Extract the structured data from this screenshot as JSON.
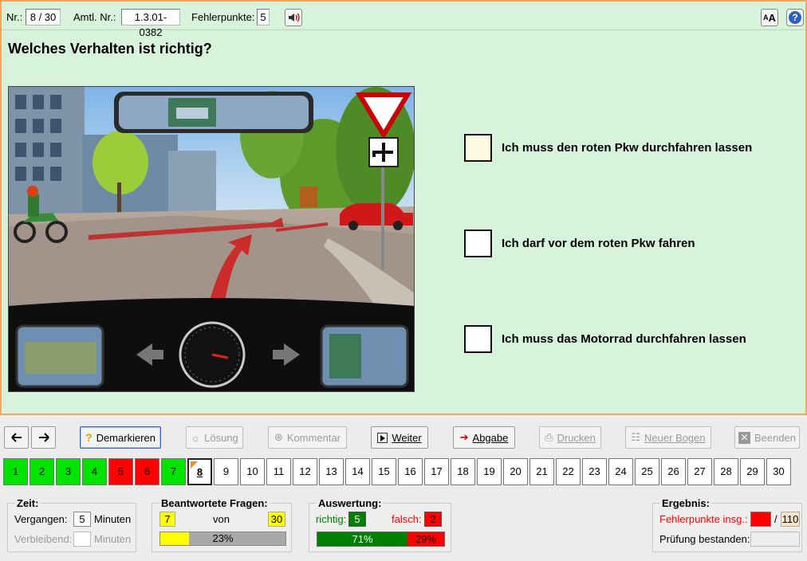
{
  "header": {
    "nr_label": "Nr.:",
    "nr_value": "8 / 30",
    "amtl_label": "Amtl. Nr.:",
    "amtl_value": "1.3.01-0382",
    "fehler_label": "Fehlerpunkte:",
    "fehler_value": "5",
    "speaker_icon": "speaker-icon",
    "font_icon": "font-size-icon",
    "help_icon": "help-icon"
  },
  "question": {
    "title": "Welches Verhalten ist richtig?",
    "answers": [
      "Ich muss den roten Pkw durchfahren lassen",
      "Ich darf vor dem roten Pkw fahren",
      "Ich muss das Motorrad durchfahren lassen"
    ]
  },
  "toolbar": {
    "demarkieren": "Demarkieren",
    "loesung": "Lösung",
    "kommentar": "Kommentar",
    "weiter": "Weiter",
    "abgabe": "Abgabe",
    "drucken": "Drucken",
    "neuer_bogen": "Neuer Bogen",
    "beenden": "Beenden"
  },
  "questions_strip": [
    {
      "n": "1",
      "state": "ok"
    },
    {
      "n": "2",
      "state": "ok"
    },
    {
      "n": "3",
      "state": "ok"
    },
    {
      "n": "4",
      "state": "ok"
    },
    {
      "n": "5",
      "state": "bad"
    },
    {
      "n": "6",
      "state": "bad"
    },
    {
      "n": "7",
      "state": "ok"
    },
    {
      "n": "8",
      "state": "cur"
    },
    {
      "n": "9",
      "state": ""
    },
    {
      "n": "10",
      "state": ""
    },
    {
      "n": "11",
      "state": ""
    },
    {
      "n": "12",
      "state": ""
    },
    {
      "n": "13",
      "state": ""
    },
    {
      "n": "14",
      "state": ""
    },
    {
      "n": "15",
      "state": ""
    },
    {
      "n": "16",
      "state": ""
    },
    {
      "n": "17",
      "state": ""
    },
    {
      "n": "18",
      "state": ""
    },
    {
      "n": "19",
      "state": ""
    },
    {
      "n": "20",
      "state": ""
    },
    {
      "n": "21",
      "state": ""
    },
    {
      "n": "22",
      "state": ""
    },
    {
      "n": "23",
      "state": ""
    },
    {
      "n": "24",
      "state": ""
    },
    {
      "n": "25",
      "state": ""
    },
    {
      "n": "26",
      "state": ""
    },
    {
      "n": "27",
      "state": ""
    },
    {
      "n": "28",
      "state": ""
    },
    {
      "n": "29",
      "state": ""
    },
    {
      "n": "30",
      "state": ""
    }
  ],
  "zeit": {
    "title": "Zeit:",
    "vergangen_label": "Vergangen:",
    "vergangen_value": "5",
    "minuten": "Minuten",
    "verbleibend_label": "Verbleibend:",
    "verbleibend_value": ""
  },
  "beantwortet": {
    "title": "Beantwortete Fragen:",
    "answered": "7",
    "von": "von",
    "total": "30",
    "percent_label": "23%",
    "fraction": 0.23
  },
  "auswertung": {
    "title": "Auswertung:",
    "richtig_label": "richtig:",
    "richtig_value": "5",
    "falsch_label": "falsch:",
    "falsch_value": "2",
    "richtig_pct": "71%",
    "falsch_pct": "29%",
    "richtig_fraction": 0.71
  },
  "ergebnis": {
    "title": "Ergebnis:",
    "fehlerpunkte_label": "Fehlerpunkte insg.:",
    "fehlerpunkte_value": "",
    "slash": "/",
    "max_value": "110",
    "bestanden_label": "Prüfung bestanden:",
    "bestanden_value": ""
  },
  "colors": {
    "ok": "#00e400",
    "bad": "#ff0000",
    "yellow": "#ffff00",
    "green_bar": "#008000"
  }
}
